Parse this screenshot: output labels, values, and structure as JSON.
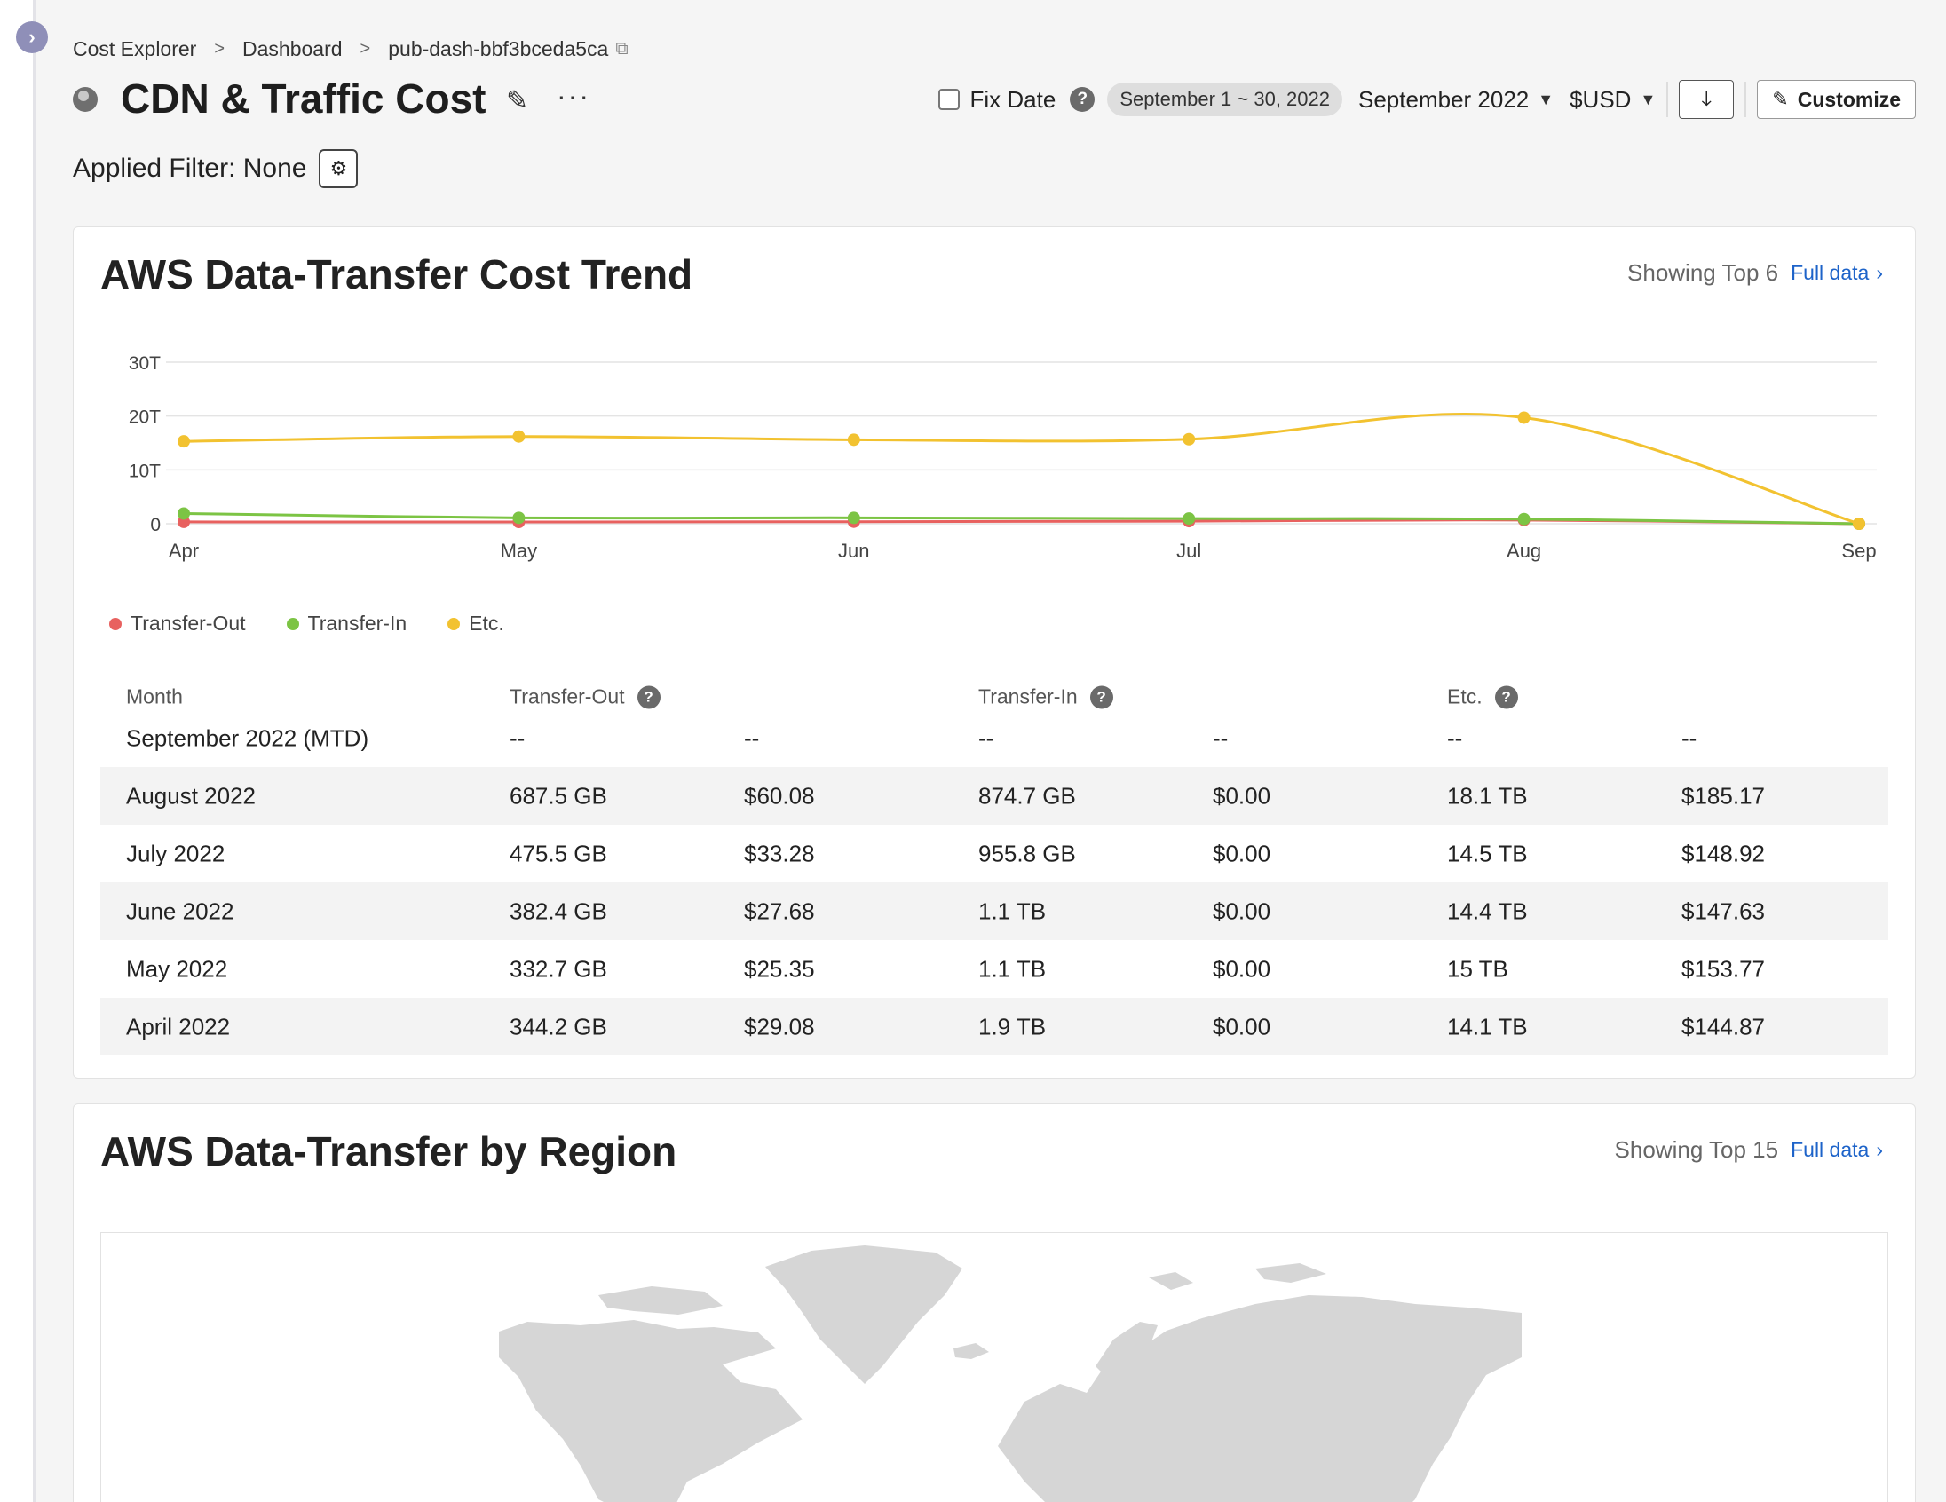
{
  "breadcrumb": {
    "items": [
      "Cost Explorer",
      "Dashboard",
      "pub-dash-bbf3bceda5ca"
    ]
  },
  "header": {
    "title": "CDN & Traffic Cost",
    "fix_date_label": "Fix Date",
    "date_range": "September 1 ~ 30, 2022",
    "month": "September 2022",
    "currency": "$USD",
    "customize_label": "Customize"
  },
  "filter": {
    "label": "Applied Filter: None"
  },
  "trend_card": {
    "title": "AWS Data-Transfer Cost Trend",
    "showing": "Showing Top 6",
    "full_data_label": "Full data"
  },
  "chart_data": {
    "type": "line",
    "x": [
      "Apr",
      "May",
      "Jun",
      "Jul",
      "Aug",
      "Sep"
    ],
    "yticks": [
      "0",
      "10T",
      "20T",
      "30T"
    ],
    "ylim": [
      0,
      30
    ],
    "grid": true,
    "legend_position": "bottom-left",
    "series": [
      {
        "name": "Transfer-Out",
        "color": "#e8615f",
        "values": [
          0.34,
          0.33,
          0.38,
          0.48,
          0.69,
          0
        ]
      },
      {
        "name": "Transfer-In",
        "color": "#7cc444",
        "values": [
          1.9,
          1.1,
          1.1,
          0.96,
          0.87,
          0
        ]
      },
      {
        "name": "Etc.",
        "color": "#f2c230",
        "values": [
          15.3,
          16.2,
          15.6,
          15.7,
          19.7,
          0
        ]
      }
    ]
  },
  "table": {
    "headers": [
      "Month",
      "Transfer-Out",
      "Transfer-In",
      "Etc."
    ],
    "rows": [
      {
        "month": "September 2022 (MTD)",
        "cells": [
          "--",
          "--",
          "--",
          "--",
          "--",
          "--"
        ]
      },
      {
        "month": "August 2022",
        "cells": [
          "687.5 GB",
          "$60.08",
          "874.7 GB",
          "$0.00",
          "18.1 TB",
          "$185.17"
        ]
      },
      {
        "month": "July 2022",
        "cells": [
          "475.5 GB",
          "$33.28",
          "955.8 GB",
          "$0.00",
          "14.5 TB",
          "$148.92"
        ]
      },
      {
        "month": "June 2022",
        "cells": [
          "382.4 GB",
          "$27.68",
          "1.1 TB",
          "$0.00",
          "14.4 TB",
          "$147.63"
        ]
      },
      {
        "month": "May 2022",
        "cells": [
          "332.7 GB",
          "$25.35",
          "1.1 TB",
          "$0.00",
          "15 TB",
          "$153.77"
        ]
      },
      {
        "month": "April 2022",
        "cells": [
          "344.2 GB",
          "$29.08",
          "1.9 TB",
          "$0.00",
          "14.1 TB",
          "$144.87"
        ]
      }
    ]
  },
  "region_card": {
    "title": "AWS Data-Transfer by Region",
    "showing": "Showing Top 15",
    "full_data_label": "Full data"
  },
  "colors": {
    "accent": "#1d63c9",
    "map_land": "#d6d6d6"
  }
}
